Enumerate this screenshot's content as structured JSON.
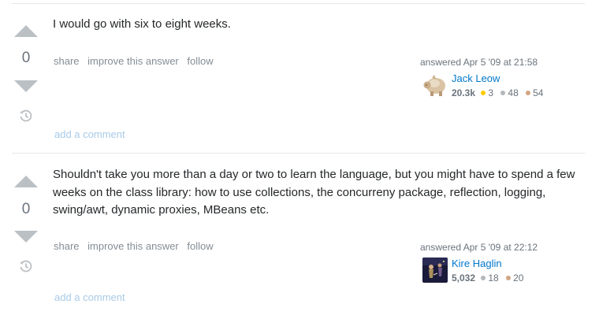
{
  "colors": {
    "vote_arrow": "#bbc0c4",
    "link_blue": "#0077cc",
    "add_comment": "#a8cae6",
    "muted": "#848d95",
    "gold": "#ffcc01",
    "silver": "#b4b8bc",
    "bronze": "#d1a684"
  },
  "answers": [
    {
      "votes": "0",
      "body": "I would go with six to eight weeks.",
      "menu": {
        "share": "share",
        "improve": "improve this answer",
        "follow": "follow"
      },
      "answered": "answered Apr 5 '09 at 21:58",
      "user": {
        "name": "Jack Leow",
        "reputation": "20.3k",
        "gold": "3",
        "silver": "48",
        "bronze": "54",
        "avatar_icon": "piggy-bank-avatar"
      },
      "add_comment": "add a comment"
    },
    {
      "votes": "0",
      "body": "Shouldn't take you more than a day or two to learn the language, but you might have to spend a few weeks on the class library: how to use collections, the concurreny package, reflection, logging, swing/awt, dynamic proxies, MBeans etc.",
      "menu": {
        "share": "share",
        "improve": "improve this answer",
        "follow": "follow"
      },
      "answered": "answered Apr 5 '09 at 22:12",
      "user": {
        "name": "Kire Haglin",
        "reputation": "5,032",
        "silver": "18",
        "bronze": "20",
        "avatar_icon": "dark-photo-avatar"
      },
      "add_comment": "add a comment"
    }
  ]
}
